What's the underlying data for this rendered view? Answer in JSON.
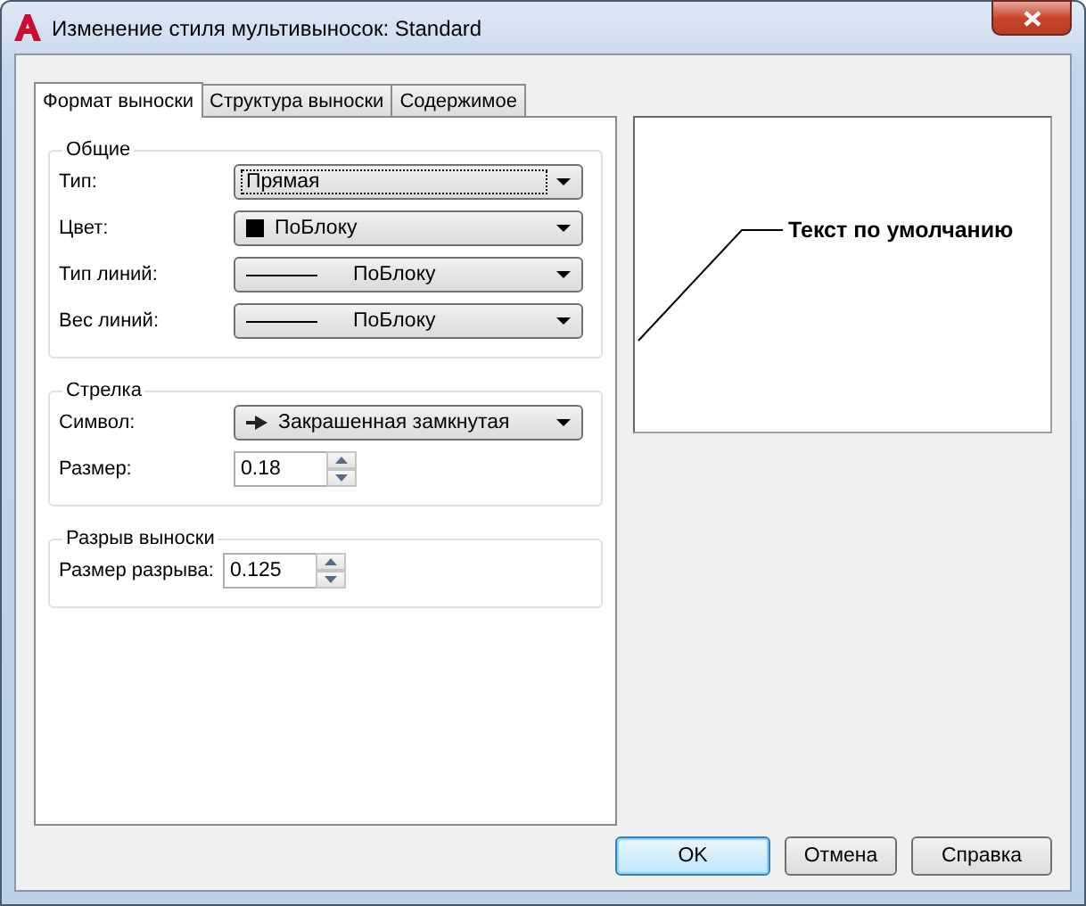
{
  "window": {
    "title": "Изменение стиля мультивыносок: Standard"
  },
  "tabs": [
    {
      "label": "Формат выноски",
      "selected": true
    },
    {
      "label": "Структура выноски",
      "selected": false
    },
    {
      "label": "Содержимое",
      "selected": false
    }
  ],
  "groups": [
    {
      "title": "Общие",
      "rows": [
        {
          "kind": "dropdown",
          "label": "Тип:",
          "value": "Прямая",
          "focused": true
        },
        {
          "kind": "color-dropdown",
          "label": "Цвет:",
          "value": "ПоБлоку",
          "focused": false
        },
        {
          "kind": "line-dropdown",
          "label": "Тип линий:",
          "value": "ПоБлоку",
          "focused": false
        },
        {
          "kind": "line-dropdown",
          "label": "Вес линий:",
          "value": "ПоБлоку",
          "focused": false
        }
      ]
    },
    {
      "title": "Стрелка",
      "rows": [
        {
          "kind": "arrow-dropdown",
          "label": "Символ:",
          "value": "Закрашенная замкнутая",
          "focused": false
        },
        {
          "kind": "spinner",
          "label": "Размер:",
          "value": "0.18",
          "focused": false
        }
      ]
    },
    {
      "title": "Разрыв выноски",
      "rows": [
        {
          "kind": "spinner",
          "label": "Размер разрыва:",
          "value": "0.125",
          "focused": false
        }
      ]
    }
  ],
  "preview": {
    "text": "Текст по умолчанию"
  },
  "buttons": [
    {
      "label": "OK",
      "default": true
    },
    {
      "label": "Отмена",
      "default": false
    },
    {
      "label": "Справка",
      "default": false
    }
  ]
}
